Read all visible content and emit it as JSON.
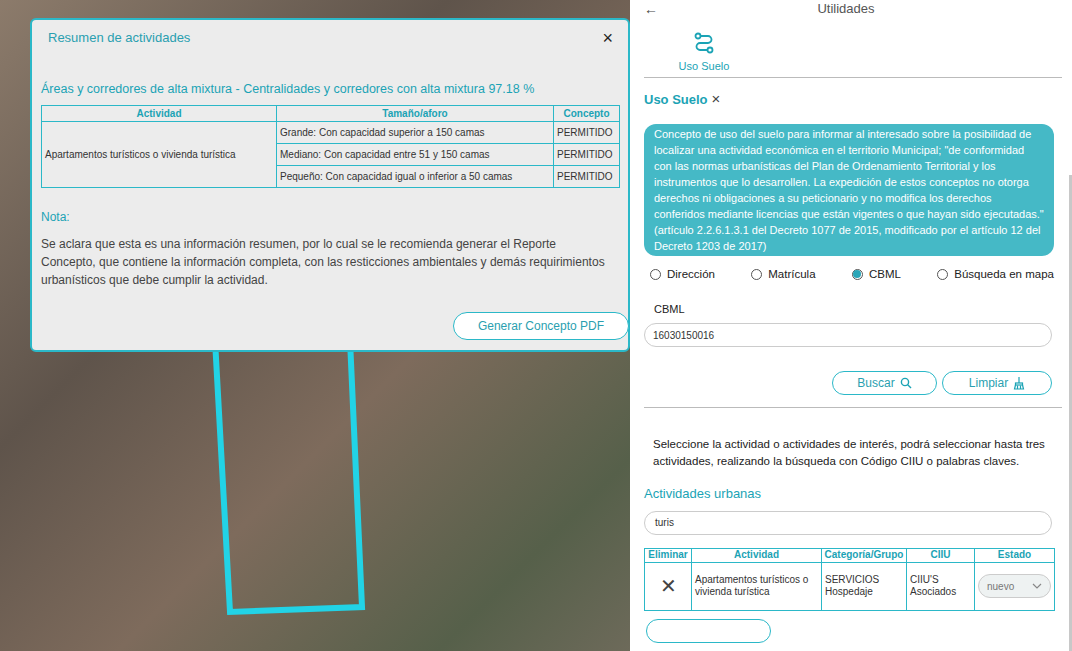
{
  "modal": {
    "title": "Resumen de actividades",
    "close": "×",
    "zone": "Áreas y corredores de alta mixtura - Centralidades y corredores con alta mixtura 97.18 %",
    "table": {
      "columns": [
        "Actividad",
        "Tamaño/aforo",
        "Concepto"
      ],
      "activity": "Apartamentos turísticos o vivienda turística",
      "rows": [
        {
          "size": "Grande: Con capacidad superior a 150 camas",
          "concept": "PERMITIDO"
        },
        {
          "size": "Mediano: Con capacidad entre 51 y 150 camas",
          "concept": "PERMITIDO"
        },
        {
          "size": "Pequeño: Con capacidad igual o inferior a 50 camas",
          "concept": "PERMITIDO"
        }
      ]
    },
    "note_label": "Nota:",
    "note": "Se aclara que esta es una información resumen, por lo cual se le recomienda generar el Reporte Concepto, que contiene la información completa, con las resticciones ambientales y demás requirimientos urbanísticos que debe cumplir la actividad.",
    "button": "Generar Concepto PDF"
  },
  "panel": {
    "back": "←",
    "title": "Utilidades",
    "tabs": [
      {
        "label": "Uso Suelo",
        "selected": true
      }
    ],
    "section": {
      "title": "Uso Suelo",
      "close": "×"
    },
    "info": "Concepto de uso del suelo para informar al interesado sobre la posibilidad de localizar una actividad económica en el territorio Municipal; \"de conformidad con las normas urbanísticas del Plan de Ordenamiento Territorial y los instrumentos que lo desarrollen. La expedición de estos conceptos no otorga derechos ni obligaciones a su peticionario y no modifica los derechos conferidos mediante licencias que están vigentes o que hayan sido ejecutadas.\" (artículo 2.2.6.1.3.1 del Decreto 1077 de 2015, modificado por el artículo 12 del Decreto 1203 de 2017)",
    "search_modes": [
      {
        "label": "Dirección",
        "selected": false
      },
      {
        "label": "Matrícula",
        "selected": false
      },
      {
        "label": "CBML",
        "selected": true
      },
      {
        "label": "Búsqueda en mapa",
        "selected": false
      }
    ],
    "field_label": "CBML",
    "field_value": "16030150016",
    "buttons": [
      {
        "label": "Buscar"
      },
      {
        "label": "Limpiar"
      }
    ],
    "instructions": "Seleccione la actividad o actividades de interés, podrá seleccionar hasta tres actividades, realizando la búsqueda con Código CIIU o palabras claves.",
    "activities_label": "Actividades urbanas",
    "activity_search": "turis",
    "table": {
      "columns": [
        "Eliminar",
        "Actividad",
        "Categoría/Grupo",
        "CIIU",
        "Estado"
      ],
      "rows": [
        {
          "remove": "✕",
          "activity": "Apartamentos turísticos o vivienda turística",
          "category": "SERVICIOS Hospedaje",
          "ciiu": "CIIU'S Asociados",
          "status": "nuevo"
        }
      ]
    }
  }
}
